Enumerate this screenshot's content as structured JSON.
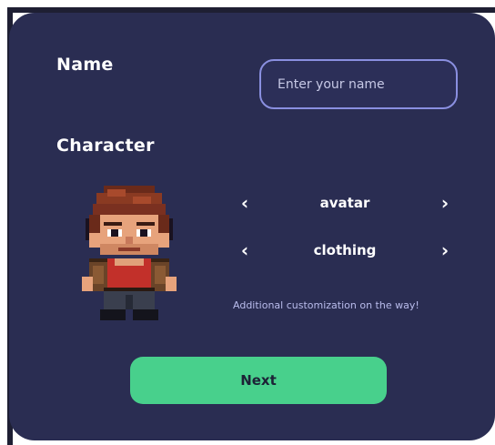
{
  "form": {
    "name_label": "Name",
    "name_placeholder": "Enter your name",
    "name_value": "",
    "character_label": "Character",
    "avatar_selector": {
      "value": "avatar",
      "prev": "‹",
      "next": "›"
    },
    "clothing_selector": {
      "value": "clothing",
      "prev": "‹",
      "next": "›"
    },
    "customization_note": "Additional customization on the way!",
    "next_label": "Next"
  },
  "colors": {
    "card_background": "#2a2d52",
    "input_border": "#8a8fe0",
    "next_button": "#48d08c",
    "note_text": "#b9bcec"
  },
  "icons": {
    "avatar": "pixel-character-sprite",
    "prev": "chevron-left-icon",
    "next": "chevron-right-icon"
  }
}
